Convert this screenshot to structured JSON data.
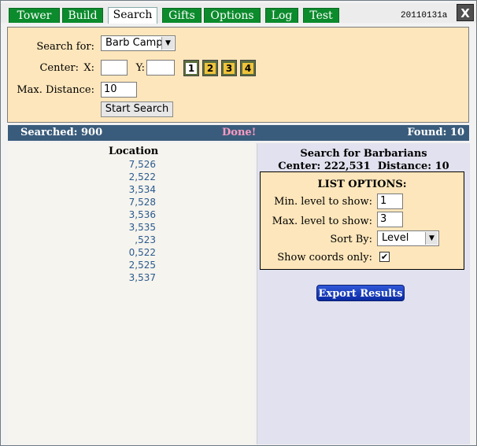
{
  "tabs": [
    {
      "label": "Tower"
    },
    {
      "label": "Build"
    },
    {
      "label": "Search",
      "selected": true
    },
    {
      "label": "Gifts"
    },
    {
      "label": "Options"
    },
    {
      "label": "Log"
    },
    {
      "label": "Test"
    }
  ],
  "version": "20110131a",
  "close_label": "X",
  "search": {
    "search_for_label": "Search for:",
    "search_for_value": "Barb Camp",
    "center_label": "Center:",
    "x_label": "X:",
    "x_value": "",
    "y_label": "Y:",
    "y_value": "",
    "city_buttons": [
      "1",
      "2",
      "3",
      "4"
    ],
    "max_distance_label": "Max. Distance:",
    "max_distance_value": "10",
    "start_label": "Start Search"
  },
  "status": {
    "searched": "Searched: 900",
    "done": "Done!",
    "found": "Found: 10"
  },
  "results": {
    "header": "Location",
    "items": [
      "7,526",
      "2,522",
      "3,534",
      "7,528",
      "3,536",
      "3,535",
      ",523",
      "0,522",
      "2,525",
      "3,537"
    ]
  },
  "summary": {
    "title": "Search for Barbarians",
    "center_label": "Center: 222,531",
    "distance_label": "Distance: 10"
  },
  "list_options": {
    "header": "LIST OPTIONS:",
    "min_level_label": "Min. level to show:",
    "min_level_value": "1",
    "max_level_label": "Max. level to show:",
    "max_level_value": "3",
    "sort_label": "Sort By:",
    "sort_value": "Level",
    "coords_only_label": "Show coords only:",
    "coords_only_checked": true
  },
  "export_label": "Export Results",
  "colors": {
    "tab_green": "#0c8b2d",
    "panel_peach": "#fde6bb",
    "status_bar": "#3a5c7c",
    "done_pink": "#ff9bc2",
    "export_blue": "#1f44c6"
  }
}
